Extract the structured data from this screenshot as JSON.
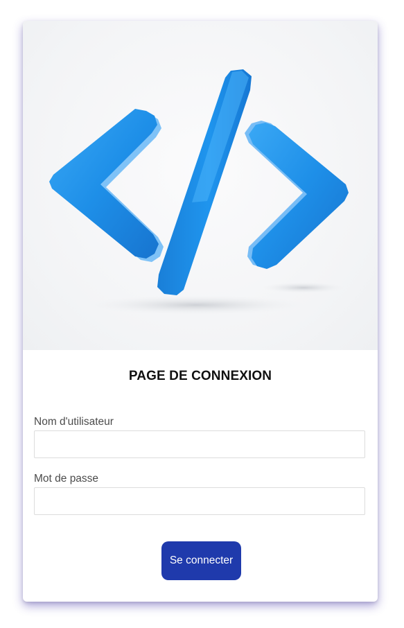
{
  "hero": {
    "image": "code-brackets-icon",
    "accent": "#1e8fe8"
  },
  "login": {
    "title": "PAGE DE CONNEXION",
    "username_label": "Nom d'utilisateur",
    "username_value": "",
    "password_label": "Mot de passe",
    "password_value": "",
    "submit_label": "Se connecter"
  },
  "colors": {
    "button": "#1f3aac",
    "card_shadow": "#4637aa"
  }
}
